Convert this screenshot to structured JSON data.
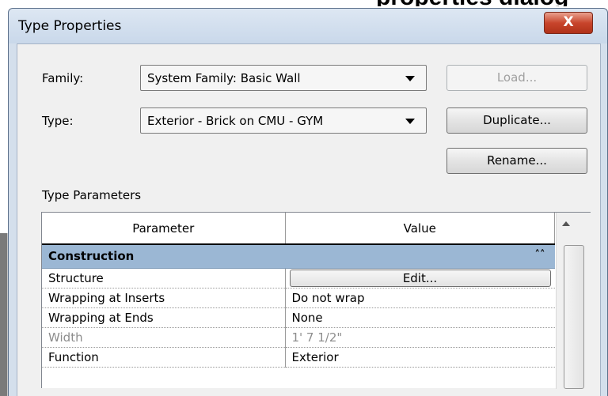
{
  "background_heading": "properties dialog",
  "window": {
    "title": "Type Properties",
    "close_glyph": "X"
  },
  "family": {
    "label": "Family:",
    "value": "System Family: Basic Wall"
  },
  "type": {
    "label": "Type:",
    "value": "Exterior - Brick on CMU - GYM"
  },
  "buttons": {
    "load": "Load...",
    "duplicate": "Duplicate...",
    "rename": "Rename..."
  },
  "type_parameters_label": "Type Parameters",
  "grid": {
    "headers": [
      "Parameter",
      "Value"
    ],
    "group": "Construction",
    "group_chevron": "»",
    "rows": [
      {
        "param": "Structure",
        "value": "Edit...",
        "is_button": true
      },
      {
        "param": "Wrapping at Inserts",
        "value": "Do not wrap"
      },
      {
        "param": "Wrapping at Ends",
        "value": "None"
      },
      {
        "param": "Width",
        "value": "1'  7 1/2\"",
        "dimmed": true
      },
      {
        "param": "Function",
        "value": "Exterior"
      }
    ]
  }
}
